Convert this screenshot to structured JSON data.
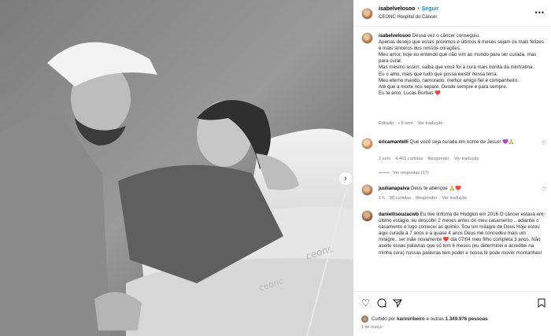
{
  "post": {
    "username": "isabelvelosoo",
    "separator": "•",
    "follow_label": "Seguir",
    "location": "CEONC Hospital do Câncer",
    "more_icon": "more-horizontal-icon",
    "photo_next_icon": "chevron-right-icon"
  },
  "caption": {
    "username": "isabelvelosoo",
    "lines": [
      "Dessa vez o câncer conseguiu.",
      "Apenas desejo que esses próximos e últimos 6 meses sejam os mais felizes e mais sinceros dos nossos corações.",
      "Meu amor, hoje eu entendo que não vim ao mundo para ser curada, mas para curar.",
      "Mas mesmo assim, saiba que você foi a cura mais bonita da minh'alma.",
      "Eu o amo, mais que tudo que possa existir nessa terra.",
      "Meu eterno marido, namorado, melhor amigo fiel e companheiro.",
      "Até que a morte nos separe. Desde sempre e para sempre.",
      "Eu te amo, Lucas Borbas ❤️"
    ],
    "meta_edited": "Editado",
    "meta_time": "• 5 sem",
    "meta_translate": "Ver tradução"
  },
  "comments": [
    {
      "username": "ericamantelli",
      "text": "Que você seja curada em nome de Jesus! 💜🙏",
      "time": "2 sem",
      "likes": "4.461 curtidas",
      "reply": "Responder",
      "translate": "Ver tradução",
      "view_replies": "Ver respostas (17)"
    },
    {
      "username": "juulianapaiva",
      "text": "Deus te abençoe 🙏❤️",
      "time": "1 h",
      "likes": "38 curtidas",
      "reply": "Responder",
      "translate": "Ver tradução"
    },
    {
      "username": "daniellisouzacwb",
      "text": "Eu tive linfoma de Hodgkin em 2016 O câncer estava em último estágio, eu descobri 2 meses antes do meu casamento .. adiantei o casamento e logo comecei as quimio. Sou um milagre de Deus Hoje estou aqui curada a 7 anos e a quase 4 anos Deus me concedeu mais um milagre.. ser mãe novamente ❤️ dia 07/04 meu filho completa 3 anos. Não aceite essas palavras que só tem 6 meses (eu determinei e acreditei na minha cura) nossas palavras tem poder e nossa fé pode mover montanhas!"
    }
  ],
  "actions": {
    "like_icon": "heart-icon",
    "comment_icon": "comment-icon",
    "share_icon": "share-icon",
    "save_icon": "bookmark-icon",
    "liked_by_prefix": "Curtido por",
    "liked_by_user": "kariniribeiro",
    "liked_by_suffix": "e outras",
    "liked_by_count": "1.349.976 pessoas",
    "date": "1 de março"
  }
}
